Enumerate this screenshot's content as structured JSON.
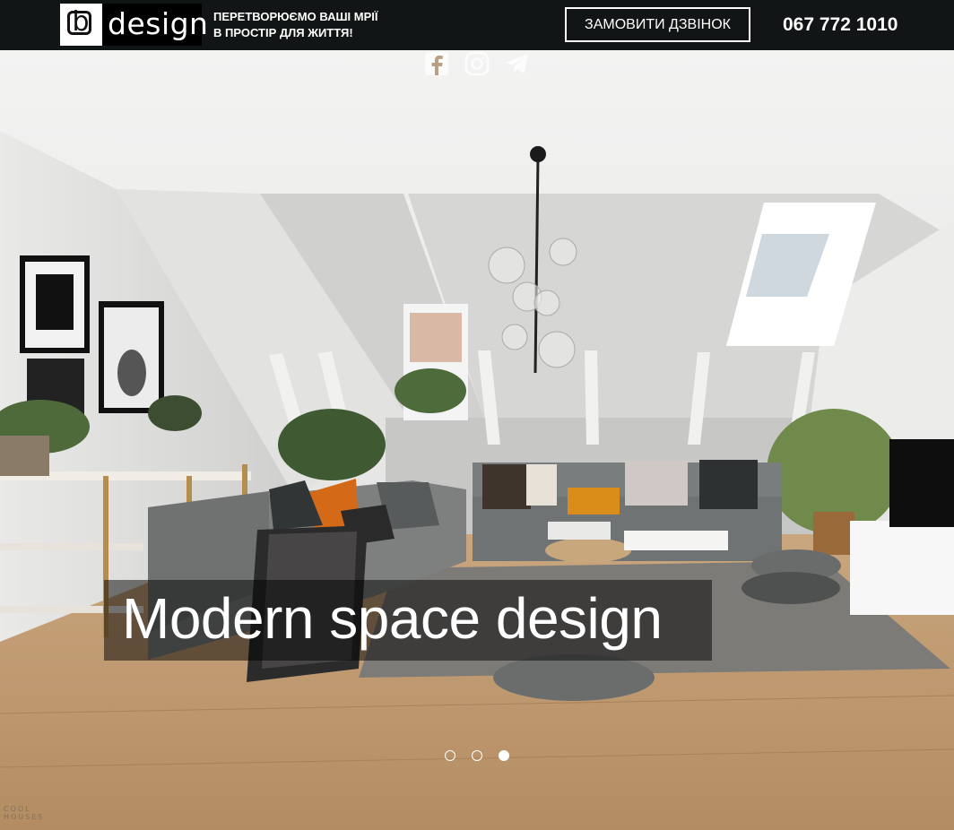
{
  "header": {
    "logo": {
      "letter": "b",
      "word": "design"
    },
    "slogan": {
      "line1": "ПЕРЕТВОРЮЄМО ВАШІ МРІЇ",
      "line2": "В ПРОСТІР ДЛЯ ЖИТТЯ!"
    },
    "callback_button": "ЗАМОВИТИ ДЗВІНОК",
    "phone": "067 772 1010"
  },
  "hero": {
    "caption": "Modern space design",
    "slides": {
      "count": 3,
      "active_index": 2
    },
    "watermark": {
      "line1": "COOL",
      "line2": "HOUSES"
    },
    "social_icons": [
      "facebook-icon",
      "instagram-icon",
      "telegram-icon"
    ]
  },
  "colors": {
    "header_bg": "#111515",
    "text_light": "#ffffff",
    "caption_overlay": "rgba(0,0,0,0.5)"
  }
}
